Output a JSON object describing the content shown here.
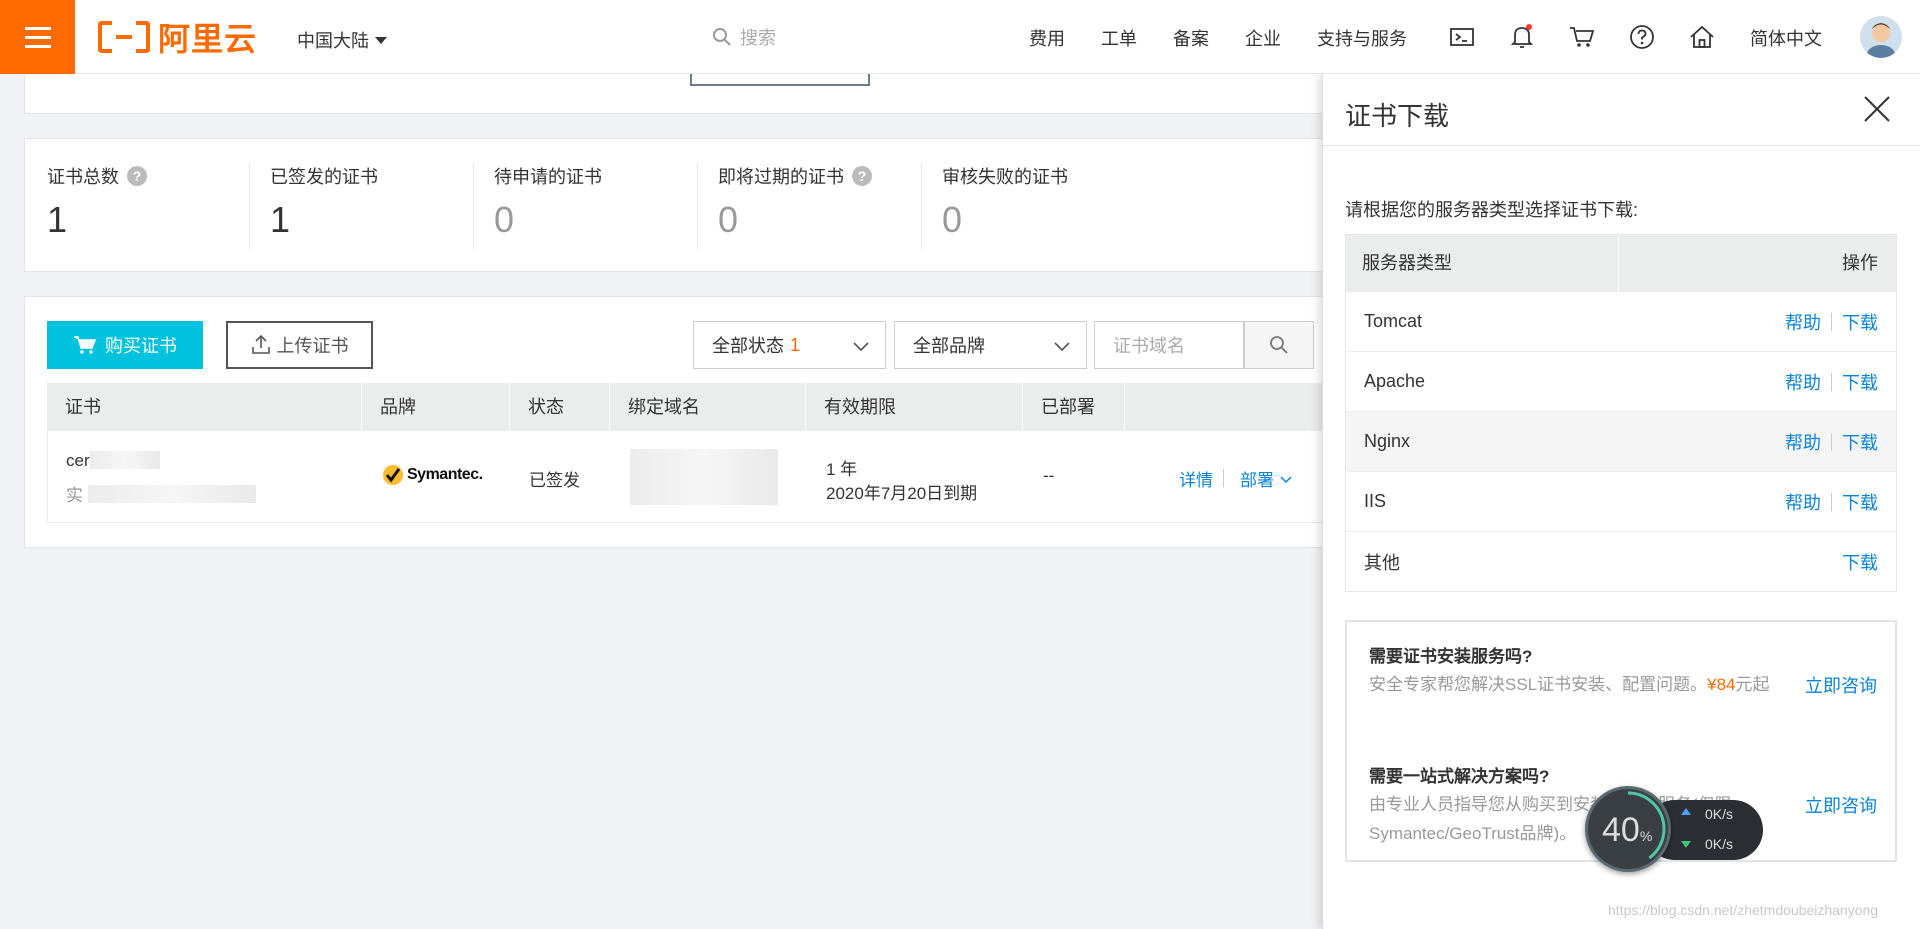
{
  "topbar": {
    "logo_text": "阿里云",
    "region": "中国大陆",
    "search_placeholder": "搜索",
    "nav": [
      "费用",
      "工单",
      "备案",
      "企业",
      "支持与服务"
    ],
    "lang": "简体中文",
    "brand_color": "#ff6a00"
  },
  "stats": [
    {
      "label": "证书总数",
      "value": "1",
      "help": true
    },
    {
      "label": "已签发的证书",
      "value": "1",
      "help": false
    },
    {
      "label": "待申请的证书",
      "value": "0",
      "help": false
    },
    {
      "label": "即将过期的证书",
      "value": "0",
      "help": true
    },
    {
      "label": "审核失败的证书",
      "value": "0",
      "help": false
    }
  ],
  "toolbar": {
    "buy_label": "购买证书",
    "upload_label": "上传证书",
    "status_filter": "全部状态",
    "status_count": "1",
    "brand_filter": "全部品牌",
    "domain_placeholder": "证书域名"
  },
  "table": {
    "headers": [
      "证书",
      "品牌",
      "状态",
      "绑定域名",
      "有效期限",
      "已部署"
    ],
    "row": {
      "cert_name": "cer",
      "cert_name_tail": "20",
      "cert_sub": "实",
      "brand": "Symantec.",
      "status": "已签发",
      "validity_years": "1 年",
      "validity_expiry": "2020年7月20日到期",
      "deployed": "--",
      "action_details": "详情",
      "action_deploy": "部署"
    }
  },
  "drawer": {
    "title": "证书下载",
    "intro": "请根据您的服务器类型选择证书下载:",
    "col_type": "服务器类型",
    "col_action": "操作",
    "help_label": "帮助",
    "download_label": "下载",
    "servers": [
      {
        "name": "Tomcat",
        "help": true
      },
      {
        "name": "Apache",
        "help": true
      },
      {
        "name": "Nginx",
        "help": true
      },
      {
        "name": "IIS",
        "help": true
      },
      {
        "name": "其他",
        "help": false
      }
    ],
    "service1_title": "需要证书安装服务吗?",
    "service1_desc_pre": "安全专家帮您解决SSL证书安装、配置问题。",
    "service1_price": "¥84",
    "service1_desc_post": "元起",
    "service1_link": "立即咨询",
    "service2_title": "需要一站式解决方案吗?",
    "service2_desc": "由专业人员指导您从购买到安装",
    "service2_desc_tail": "部署的服务(仅限Symantec/GeoTrust品牌)。",
    "service2_link": "立即咨询"
  },
  "speed_widget": {
    "percent": "40",
    "percent_unit": "%",
    "up": "0K/s",
    "down": "0K/s"
  },
  "watermark": "https://blog.csdn.net/zhetmdoubeizhanyong"
}
